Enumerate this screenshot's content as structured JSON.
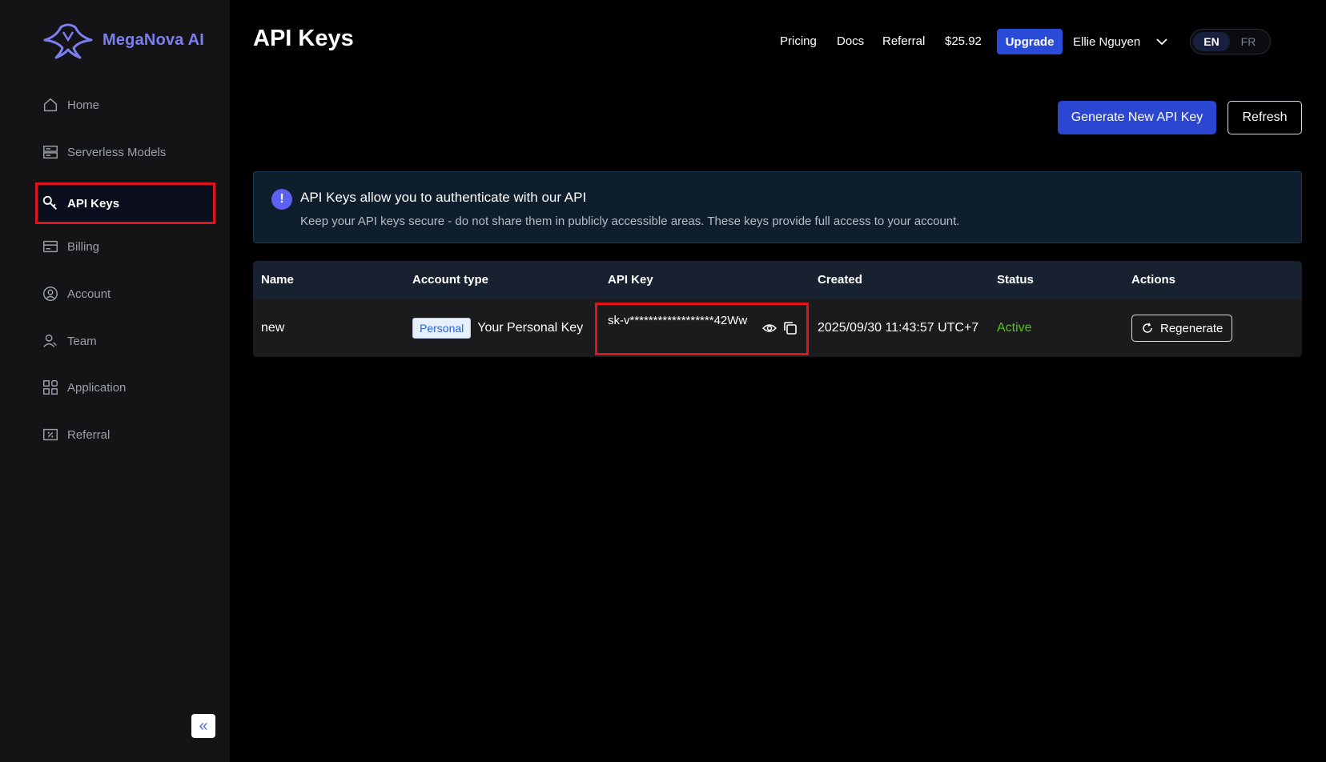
{
  "app": {
    "logo_text": "MegaNova AI"
  },
  "sidebar": {
    "items": [
      {
        "label": "Home",
        "icon": "home-icon"
      },
      {
        "label": "Serverless Models",
        "icon": "server-icon"
      },
      {
        "label": "API Keys",
        "icon": "key-icon"
      },
      {
        "label": "Billing",
        "icon": "billing-icon"
      },
      {
        "label": "Account",
        "icon": "account-icon"
      },
      {
        "label": "Team",
        "icon": "team-icon"
      },
      {
        "label": "Application",
        "icon": "application-icon"
      },
      {
        "label": "Referral",
        "icon": "referral-icon"
      }
    ],
    "active_item": "API Keys",
    "collapse_glyph": "«"
  },
  "header": {
    "title": "API Keys",
    "links": [
      "Pricing",
      "Docs",
      "Referral"
    ],
    "balance": "$25.92",
    "upgrade_label": "Upgrade",
    "user_name": "Ellie Nguyen",
    "languages": [
      "EN",
      "FR"
    ],
    "active_language": "EN"
  },
  "actions": {
    "generate_label": "Generate New API Key",
    "refresh_label": "Refresh"
  },
  "alert": {
    "icon": "!",
    "title": "API Keys allow you to authenticate with our API",
    "description": "Keep your API keys secure - do not share them in publicly accessible areas. These keys provide full access to your account."
  },
  "table": {
    "columns": [
      "Name",
      "Account type",
      "API Key",
      "Created",
      "Status",
      "Actions"
    ],
    "rows": [
      {
        "name": "new",
        "account_badge": "Personal",
        "account_label": "Your Personal Key",
        "api_key": "sk-v******************42Ww",
        "created": "2025/09/30 11:43:57 UTC+7",
        "status": "Active",
        "action_label": "Regenerate"
      }
    ]
  },
  "colors": {
    "accent": "#2b46d0",
    "logo": "#7b7ff0",
    "status_active": "#52c41a",
    "highlight": "#e0141c"
  }
}
